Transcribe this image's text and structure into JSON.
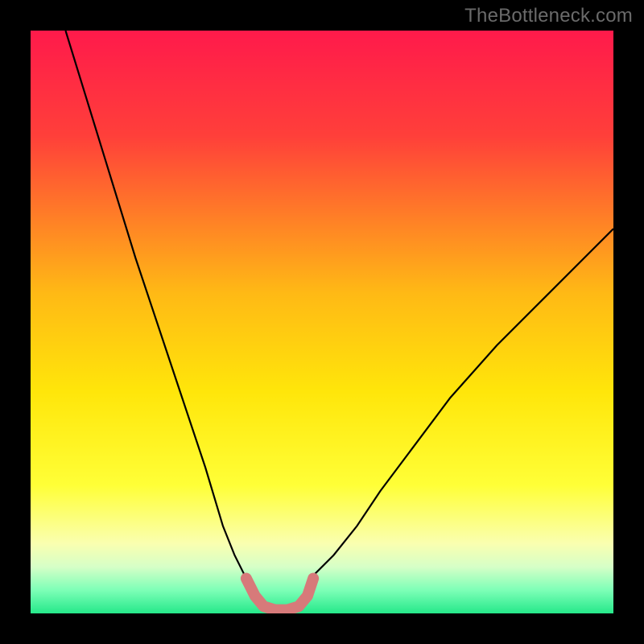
{
  "watermark": "TheBottleneck.com",
  "chart_data": {
    "type": "line",
    "title": "",
    "xlabel": "",
    "ylabel": "",
    "xlim": [
      0,
      100
    ],
    "ylim": [
      0,
      100
    ],
    "grid": false,
    "legend": false,
    "gradient_stops": [
      {
        "offset": 0.0,
        "color": "#ff1a4b"
      },
      {
        "offset": 0.18,
        "color": "#ff3f3a"
      },
      {
        "offset": 0.45,
        "color": "#ffb915"
      },
      {
        "offset": 0.62,
        "color": "#ffe60a"
      },
      {
        "offset": 0.78,
        "color": "#ffff37"
      },
      {
        "offset": 0.88,
        "color": "#faffb0"
      },
      {
        "offset": 0.92,
        "color": "#d6ffc7"
      },
      {
        "offset": 0.96,
        "color": "#7dffb7"
      },
      {
        "offset": 1.0,
        "color": "#25e88a"
      }
    ],
    "series": [
      {
        "name": "left_curve_thin",
        "stroke": "#000000",
        "stroke_width": 2.2,
        "x": [
          6,
          10,
          14,
          18,
          22,
          26,
          30,
          33,
          35,
          37
        ],
        "y": [
          100,
          87,
          74,
          61,
          49,
          37,
          25,
          15,
          10,
          6
        ]
      },
      {
        "name": "right_curve_thin",
        "stroke": "#000000",
        "stroke_width": 2.2,
        "x": [
          48,
          52,
          56,
          60,
          66,
          72,
          80,
          88,
          96,
          100
        ],
        "y": [
          6,
          10,
          15,
          21,
          29,
          37,
          46,
          54,
          62,
          66
        ]
      },
      {
        "name": "bottom_u_thick",
        "stroke": "#d77a7a",
        "stroke_width": 14,
        "linecap": "round",
        "x": [
          37,
          38.5,
          40,
          42,
          44,
          46,
          47.5,
          48.5
        ],
        "y": [
          6,
          3,
          1.2,
          0.6,
          0.6,
          1.2,
          3,
          6
        ]
      }
    ],
    "annotations": []
  }
}
